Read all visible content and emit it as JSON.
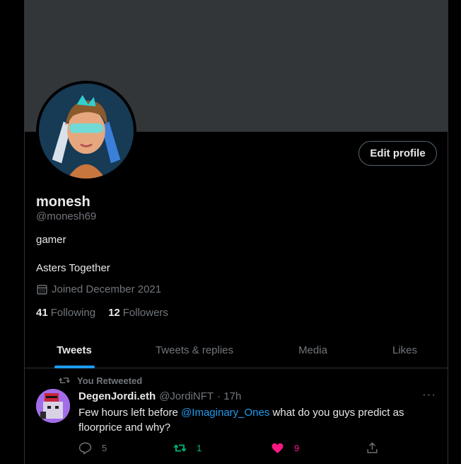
{
  "profile": {
    "display_name": "monesh",
    "handle": "@monesh69",
    "bio": "gamer",
    "location": "Asters Together",
    "joined": "Joined December 2021",
    "edit_label": "Edit profile",
    "following_count": "41",
    "following_label": "Following",
    "followers_count": "12",
    "followers_label": "Followers"
  },
  "tabs": [
    "Tweets",
    "Tweets & replies",
    "Media",
    "Likes"
  ],
  "active_tab": "Tweets",
  "tweet": {
    "retweet_label": "You Retweeted",
    "author_name": "DegenJordi.eth",
    "author_handle": "@JordiNFT",
    "time": "· 17h",
    "text_before": "Few hours left before ",
    "mention": "@Imaginary_Ones",
    "text_after": " what do you guys predict as floorprice and why?",
    "more": "···",
    "replies": "5",
    "retweets": "1",
    "likes": "9"
  },
  "icons": {
    "calendar": "calendar-icon",
    "retweet": "retweet-icon",
    "reply": "reply-icon",
    "like": "heart-icon",
    "share": "share-icon"
  },
  "colors": {
    "background": "#000000",
    "banner": "#333639",
    "accent": "#1d9bf0",
    "retweet": "#00ba7c",
    "like": "#f91880",
    "muted": "#71767b"
  }
}
